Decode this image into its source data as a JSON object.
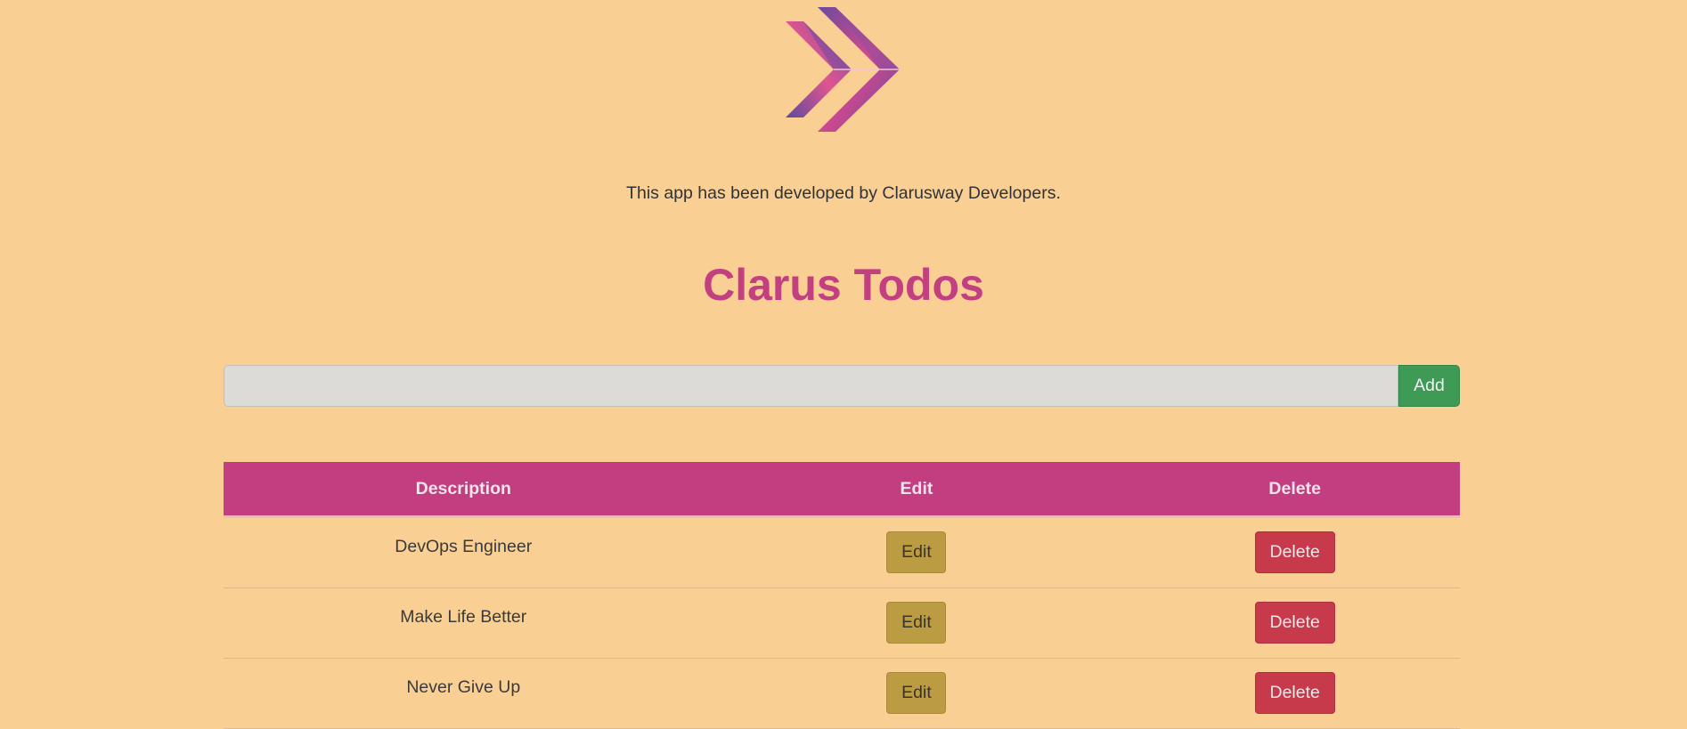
{
  "credit_text": "This app has been developed by Clarusway Developers.",
  "title": "Clarus Todos",
  "form": {
    "input_value": "",
    "add_label": "Add"
  },
  "table": {
    "headers": [
      "Description",
      "Edit",
      "Delete"
    ],
    "rows": [
      {
        "description": "DevOps Engineer",
        "edit_label": "Edit",
        "delete_label": "Delete"
      },
      {
        "description": "Make Life Better",
        "edit_label": "Edit",
        "delete_label": "Delete"
      },
      {
        "description": "Never Give Up",
        "edit_label": "Edit",
        "delete_label": "Delete"
      }
    ]
  },
  "colors": {
    "background": "#f9cf94",
    "accent": "#c2407f",
    "add_button": "#3f9a56",
    "edit_button": "#bc9c42",
    "delete_button": "#c73a4c"
  },
  "icons": {
    "logo": "double-chevron-logo-icon"
  }
}
